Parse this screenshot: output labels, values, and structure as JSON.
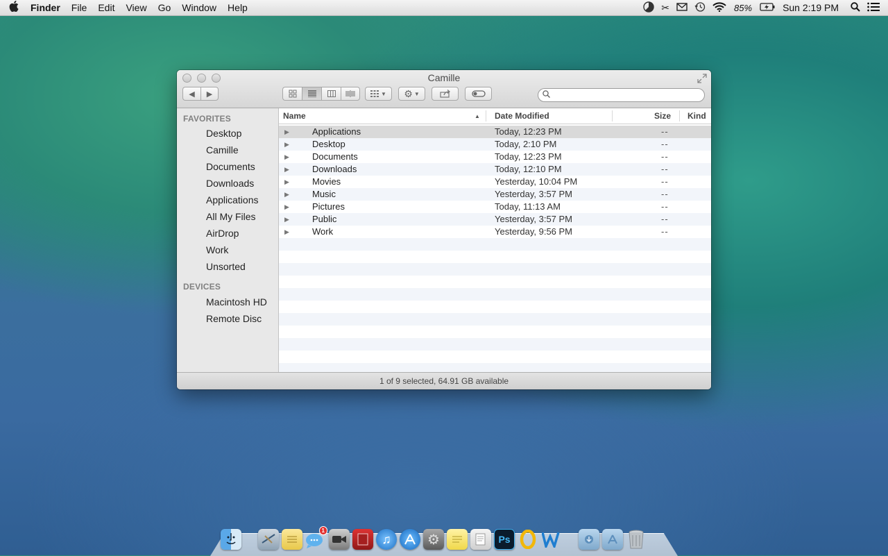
{
  "menubar": {
    "apple": "",
    "app_name": "Finder",
    "items": [
      "File",
      "Edit",
      "View",
      "Go",
      "Window",
      "Help"
    ],
    "battery": "85%",
    "clock": "Sun 2:19 PM"
  },
  "window": {
    "title": "Camille",
    "search_placeholder": ""
  },
  "sidebar": {
    "favorites_heading": "FAVORITES",
    "favorites": [
      "Desktop",
      "Camille",
      "Documents",
      "Downloads",
      "Applications",
      "All My Files",
      "AirDrop",
      "Work",
      "Unsorted"
    ],
    "devices_heading": "DEVICES",
    "devices": [
      "Macintosh HD",
      "Remote Disc"
    ]
  },
  "columns": {
    "name": "Name",
    "date": "Date Modified",
    "size": "Size",
    "kind": "Kind"
  },
  "files": [
    {
      "name": "Applications",
      "date": "Today, 12:23 PM",
      "size": "--",
      "selected": true
    },
    {
      "name": "Desktop",
      "date": "Today, 2:10 PM",
      "size": "--"
    },
    {
      "name": "Documents",
      "date": "Today, 12:23 PM",
      "size": "--"
    },
    {
      "name": "Downloads",
      "date": "Today, 12:10 PM",
      "size": "--"
    },
    {
      "name": "Movies",
      "date": "Yesterday, 10:04 PM",
      "size": "--"
    },
    {
      "name": "Music",
      "date": "Yesterday, 3:57 PM",
      "size": "--"
    },
    {
      "name": "Pictures",
      "date": "Today, 11:13 AM",
      "size": "--"
    },
    {
      "name": "Public",
      "date": "Yesterday, 3:57 PM",
      "size": "--"
    },
    {
      "name": "Work",
      "date": "Yesterday, 9:56 PM",
      "size": "--"
    }
  ],
  "status": "1 of 9 selected, 64.91 GB available",
  "dock": {
    "messages_badge": "1",
    "photoshop_label": "Ps"
  }
}
